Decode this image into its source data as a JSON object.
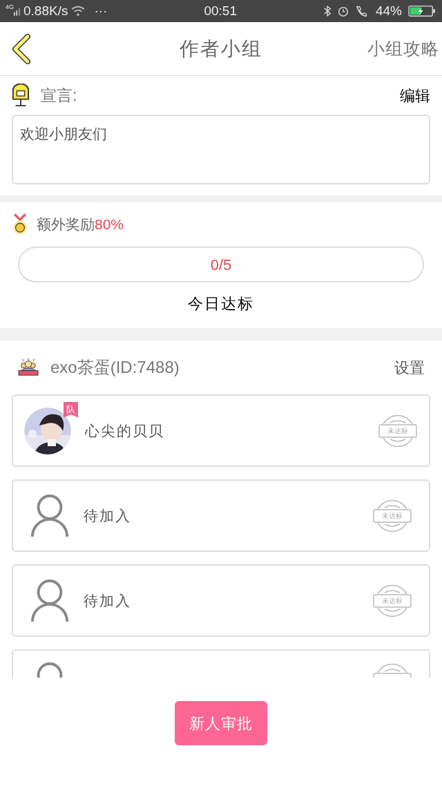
{
  "status_bar": {
    "network": "4G",
    "speed": "0.88K/s",
    "dots": "···",
    "time": "00:51",
    "battery": "44%"
  },
  "header": {
    "title": "作者小组",
    "action": "小组攻略"
  },
  "declaration": {
    "label": "宣言:",
    "edit": "编辑",
    "text": "欢迎小朋友们"
  },
  "reward": {
    "label": "额外奖励",
    "percent": "80%",
    "progress": {
      "reading": "0/5"
    },
    "caption": "今日达标"
  },
  "group": {
    "name": "exo茶蛋(ID:7488)",
    "settings": "设置",
    "members": [
      {
        "kind": "member",
        "name": "心尖的贝贝",
        "badge": "队",
        "stamp": "未达标"
      },
      {
        "kind": "empty",
        "name": "待加入",
        "stamp": "未达标"
      },
      {
        "kind": "empty",
        "name": "待加入",
        "stamp": "未达标"
      },
      {
        "kind": "cut"
      }
    ]
  },
  "approve_button": "新人审批"
}
